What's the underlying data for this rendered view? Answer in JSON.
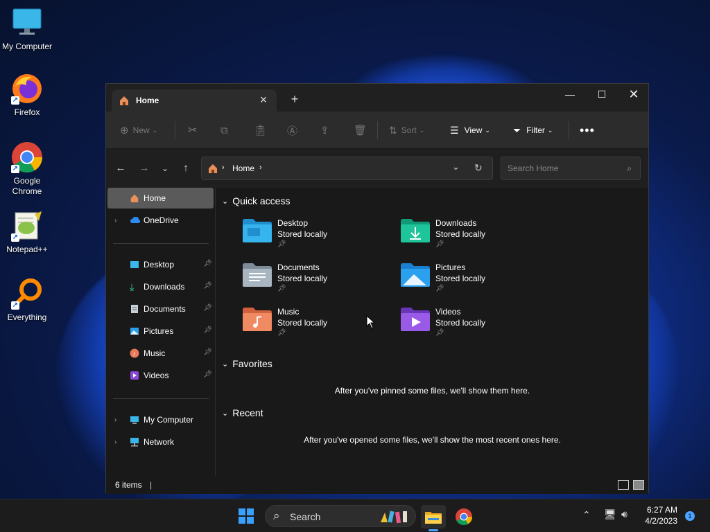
{
  "desktop": {
    "icons": [
      {
        "label": "My Computer"
      },
      {
        "label": "Firefox"
      },
      {
        "label": "Google Chrome"
      },
      {
        "label": "Notepad++"
      },
      {
        "label": "Everything"
      }
    ]
  },
  "window": {
    "tab_title": "Home",
    "toolbar": {
      "new_label": "New",
      "sort_label": "Sort",
      "view_label": "View",
      "filter_label": "Filter"
    },
    "address": {
      "crumb": "Home"
    },
    "search": {
      "placeholder": "Search Home"
    },
    "sidebar": {
      "items": [
        {
          "label": "Home"
        },
        {
          "label": "OneDrive"
        },
        {
          "label": "Desktop"
        },
        {
          "label": "Downloads"
        },
        {
          "label": "Documents"
        },
        {
          "label": "Pictures"
        },
        {
          "label": "Music"
        },
        {
          "label": "Videos"
        },
        {
          "label": "My Computer"
        },
        {
          "label": "Network"
        }
      ]
    },
    "quick_access": {
      "heading": "Quick access",
      "items": [
        {
          "name": "Desktop",
          "sub": "Stored locally"
        },
        {
          "name": "Downloads",
          "sub": "Stored locally"
        },
        {
          "name": "Documents",
          "sub": "Stored locally"
        },
        {
          "name": "Pictures",
          "sub": "Stored locally"
        },
        {
          "name": "Music",
          "sub": "Stored locally"
        },
        {
          "name": "Videos",
          "sub": "Stored locally"
        }
      ]
    },
    "favorites": {
      "heading": "Favorites",
      "message": "After you've pinned some files, we'll show them here."
    },
    "recent": {
      "heading": "Recent",
      "message": "After you've opened some files, we'll show the most recent ones here."
    },
    "status": {
      "items_count": "6 items"
    }
  },
  "taskbar": {
    "search_label": "Search",
    "time": "6:27 AM",
    "date": "4/2/2023",
    "notification_count": "1"
  },
  "colors": {
    "accent": "#4aa3ff",
    "window_bg": "#191919",
    "toolbar_bg": "#2c2c2c"
  }
}
